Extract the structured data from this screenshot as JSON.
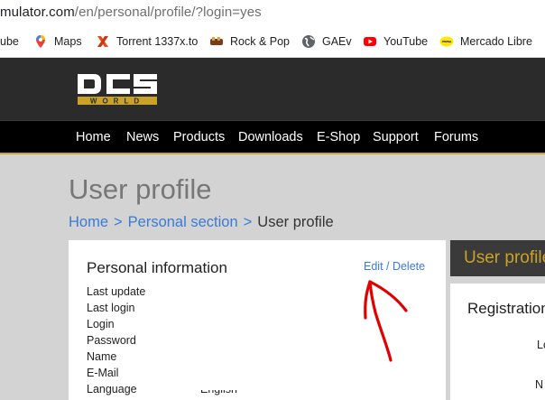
{
  "browser": {
    "url_main": "mulator.com",
    "url_path": "/en/personal/profile/?login=yes",
    "bookmarks": [
      {
        "label": "ube",
        "icon": "youtube-icon"
      },
      {
        "label": "Maps",
        "icon": "maps-pin-icon"
      },
      {
        "label": "Torrent 1337x.to",
        "icon": "x-logo-icon"
      },
      {
        "label": "Rock & Pop",
        "icon": "rock-pop-icon"
      },
      {
        "label": "GAEv",
        "icon": "globe-icon"
      },
      {
        "label": "YouTube",
        "icon": "youtube-icon"
      },
      {
        "label": "Mercado Libre",
        "icon": "mercado-libre-icon"
      }
    ]
  },
  "site": {
    "logo_text": "DCS",
    "logo_sub": "WORLD",
    "nav": [
      "Home",
      "News",
      "Products",
      "Downloads",
      "E-Shop",
      "Support",
      "Forums"
    ]
  },
  "page": {
    "title": "User profile",
    "breadcrumb": {
      "home": "Home",
      "section": "Personal section",
      "current": "User profile",
      "separator": ">"
    }
  },
  "personal": {
    "heading": "Personal information",
    "edit_link": "Edit / Delete",
    "fields": [
      {
        "label": "Last update",
        "value": ""
      },
      {
        "label": "Last login",
        "value": ""
      },
      {
        "label": "Login",
        "value": ""
      },
      {
        "label": "Password",
        "value": ""
      },
      {
        "label": "Name",
        "value": ""
      },
      {
        "label": "E-Mail",
        "value": ""
      },
      {
        "label": "Language",
        "value": "English"
      }
    ]
  },
  "sidebar": {
    "heading": "User profile",
    "registration": "Registration",
    "label1": "Lo",
    "label2": "N"
  },
  "colors": {
    "accent_gold": "#c9a227",
    "link_blue": "#3a7bd5",
    "annotation_red": "#e00000"
  }
}
